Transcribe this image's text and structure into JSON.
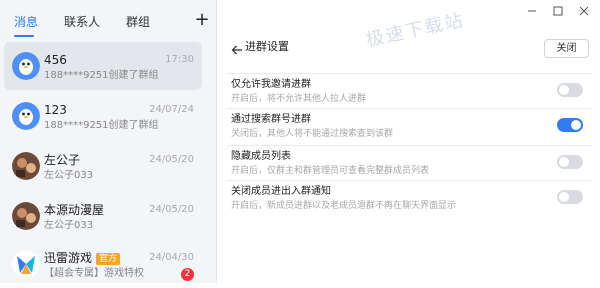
{
  "tabs": [
    {
      "label": "消息",
      "active": true
    },
    {
      "label": "联系人",
      "active": false
    },
    {
      "label": "群组",
      "active": false
    }
  ],
  "add_label": "+",
  "chats": [
    {
      "name": "456",
      "preview": "188****9251创建了群组",
      "time": "17:30",
      "avatar": "qq-penguin",
      "selected": true
    },
    {
      "name": "123",
      "preview": "188****9251创建了群组",
      "time": "24/07/24",
      "avatar": "qq-penguin",
      "selected": false
    },
    {
      "name": "左公子",
      "preview": "左公子033",
      "time": "24/05/20",
      "avatar": "photo-avatar",
      "selected": false
    },
    {
      "name": "本源动漫屋",
      "preview": "左公子033",
      "time": "24/05/20",
      "avatar": "photo-avatar",
      "selected": false
    },
    {
      "name": "迅雷游戏",
      "badge": "官方",
      "preview": "【超会专属】游戏特权",
      "time": "24/04/30",
      "unread": "2",
      "avatar": "xunlei-logo",
      "selected": false
    }
  ],
  "window_controls": [
    "minimize-icon",
    "maximize-icon",
    "close-icon"
  ],
  "watermark": "极速下载站",
  "header": {
    "title": "进群设置",
    "close_label": "关闭"
  },
  "settings": [
    {
      "title": "仅允许我邀请进群",
      "desc": "开启后，将不允许其他人拉人进群",
      "on": false
    },
    {
      "title": "通过搜索群号进群",
      "desc": "关闭后，其他人将不能通过搜索查到该群",
      "on": true
    },
    {
      "title": "隐藏成员列表",
      "desc": "开启后，仅群主和群管理员可查看完整群成员列表",
      "on": false
    },
    {
      "title": "关闭成员进出入群通知",
      "desc": "开启后，新成员进群以及老成员退群不再在聊天界面显示",
      "on": false
    }
  ],
  "colors": {
    "accent": "#2f7cf6",
    "toggle_off": "#d9dbe0",
    "badge_official": "#f6a623",
    "badge_unread": "#e8383d"
  }
}
